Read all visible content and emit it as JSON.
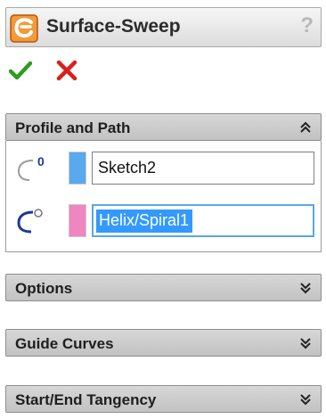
{
  "feature": {
    "title": "Surface-Sweep",
    "help_label": "?",
    "icon": "surface-sweep-icon",
    "accent_color": "#e8731a"
  },
  "actions": {
    "ok_icon": "checkmark-icon",
    "cancel_icon": "x-icon"
  },
  "groups": [
    {
      "label": "Profile and Path",
      "state": "expanded"
    },
    {
      "label": "Options",
      "state": "collapsed"
    },
    {
      "label": "Guide Curves",
      "state": "collapsed"
    },
    {
      "label": "Start/End Tangency",
      "state": "collapsed"
    }
  ],
  "profile_path": {
    "profile": {
      "value": "Sketch2",
      "swatch_color": "#59a9ef",
      "icon": "profile-icon"
    },
    "path": {
      "value": "Helix/Spiral1",
      "swatch_color": "#ef86c0",
      "icon": "path-icon",
      "selected": true
    }
  }
}
